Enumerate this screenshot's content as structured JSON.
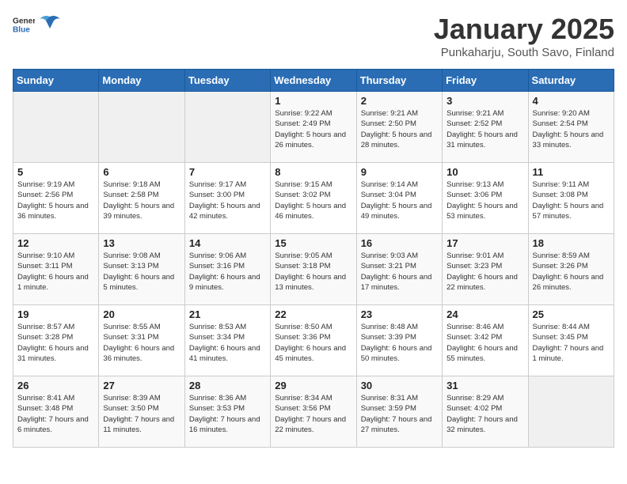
{
  "header": {
    "logo_general": "General",
    "logo_blue": "Blue",
    "title": "January 2025",
    "subtitle": "Punkaharju, South Savo, Finland"
  },
  "days_of_week": [
    "Sunday",
    "Monday",
    "Tuesday",
    "Wednesday",
    "Thursday",
    "Friday",
    "Saturday"
  ],
  "weeks": [
    [
      {
        "day": null,
        "sunrise": null,
        "sunset": null,
        "daylight": null
      },
      {
        "day": null,
        "sunrise": null,
        "sunset": null,
        "daylight": null
      },
      {
        "day": null,
        "sunrise": null,
        "sunset": null,
        "daylight": null
      },
      {
        "day": "1",
        "sunrise": "9:22 AM",
        "sunset": "2:49 PM",
        "daylight": "5 hours and 26 minutes."
      },
      {
        "day": "2",
        "sunrise": "9:21 AM",
        "sunset": "2:50 PM",
        "daylight": "5 hours and 28 minutes."
      },
      {
        "day": "3",
        "sunrise": "9:21 AM",
        "sunset": "2:52 PM",
        "daylight": "5 hours and 31 minutes."
      },
      {
        "day": "4",
        "sunrise": "9:20 AM",
        "sunset": "2:54 PM",
        "daylight": "5 hours and 33 minutes."
      }
    ],
    [
      {
        "day": "5",
        "sunrise": "9:19 AM",
        "sunset": "2:56 PM",
        "daylight": "5 hours and 36 minutes."
      },
      {
        "day": "6",
        "sunrise": "9:18 AM",
        "sunset": "2:58 PM",
        "daylight": "5 hours and 39 minutes."
      },
      {
        "day": "7",
        "sunrise": "9:17 AM",
        "sunset": "3:00 PM",
        "daylight": "5 hours and 42 minutes."
      },
      {
        "day": "8",
        "sunrise": "9:15 AM",
        "sunset": "3:02 PM",
        "daylight": "5 hours and 46 minutes."
      },
      {
        "day": "9",
        "sunrise": "9:14 AM",
        "sunset": "3:04 PM",
        "daylight": "5 hours and 49 minutes."
      },
      {
        "day": "10",
        "sunrise": "9:13 AM",
        "sunset": "3:06 PM",
        "daylight": "5 hours and 53 minutes."
      },
      {
        "day": "11",
        "sunrise": "9:11 AM",
        "sunset": "3:08 PM",
        "daylight": "5 hours and 57 minutes."
      }
    ],
    [
      {
        "day": "12",
        "sunrise": "9:10 AM",
        "sunset": "3:11 PM",
        "daylight": "6 hours and 1 minute."
      },
      {
        "day": "13",
        "sunrise": "9:08 AM",
        "sunset": "3:13 PM",
        "daylight": "6 hours and 5 minutes."
      },
      {
        "day": "14",
        "sunrise": "9:06 AM",
        "sunset": "3:16 PM",
        "daylight": "6 hours and 9 minutes."
      },
      {
        "day": "15",
        "sunrise": "9:05 AM",
        "sunset": "3:18 PM",
        "daylight": "6 hours and 13 minutes."
      },
      {
        "day": "16",
        "sunrise": "9:03 AM",
        "sunset": "3:21 PM",
        "daylight": "6 hours and 17 minutes."
      },
      {
        "day": "17",
        "sunrise": "9:01 AM",
        "sunset": "3:23 PM",
        "daylight": "6 hours and 22 minutes."
      },
      {
        "day": "18",
        "sunrise": "8:59 AM",
        "sunset": "3:26 PM",
        "daylight": "6 hours and 26 minutes."
      }
    ],
    [
      {
        "day": "19",
        "sunrise": "8:57 AM",
        "sunset": "3:28 PM",
        "daylight": "6 hours and 31 minutes."
      },
      {
        "day": "20",
        "sunrise": "8:55 AM",
        "sunset": "3:31 PM",
        "daylight": "6 hours and 36 minutes."
      },
      {
        "day": "21",
        "sunrise": "8:53 AM",
        "sunset": "3:34 PM",
        "daylight": "6 hours and 41 minutes."
      },
      {
        "day": "22",
        "sunrise": "8:50 AM",
        "sunset": "3:36 PM",
        "daylight": "6 hours and 45 minutes."
      },
      {
        "day": "23",
        "sunrise": "8:48 AM",
        "sunset": "3:39 PM",
        "daylight": "6 hours and 50 minutes."
      },
      {
        "day": "24",
        "sunrise": "8:46 AM",
        "sunset": "3:42 PM",
        "daylight": "6 hours and 55 minutes."
      },
      {
        "day": "25",
        "sunrise": "8:44 AM",
        "sunset": "3:45 PM",
        "daylight": "7 hours and 1 minute."
      }
    ],
    [
      {
        "day": "26",
        "sunrise": "8:41 AM",
        "sunset": "3:48 PM",
        "daylight": "7 hours and 6 minutes."
      },
      {
        "day": "27",
        "sunrise": "8:39 AM",
        "sunset": "3:50 PM",
        "daylight": "7 hours and 11 minutes."
      },
      {
        "day": "28",
        "sunrise": "8:36 AM",
        "sunset": "3:53 PM",
        "daylight": "7 hours and 16 minutes."
      },
      {
        "day": "29",
        "sunrise": "8:34 AM",
        "sunset": "3:56 PM",
        "daylight": "7 hours and 22 minutes."
      },
      {
        "day": "30",
        "sunrise": "8:31 AM",
        "sunset": "3:59 PM",
        "daylight": "7 hours and 27 minutes."
      },
      {
        "day": "31",
        "sunrise": "8:29 AM",
        "sunset": "4:02 PM",
        "daylight": "7 hours and 32 minutes."
      },
      {
        "day": null,
        "sunrise": null,
        "sunset": null,
        "daylight": null
      }
    ]
  ]
}
